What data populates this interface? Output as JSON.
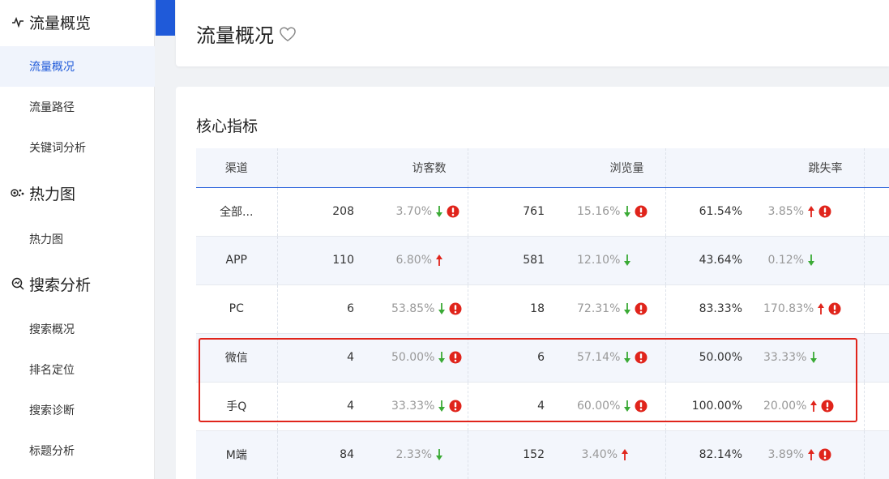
{
  "sidebar": {
    "groups": [
      {
        "label": "流量概览",
        "icon": "pulse-icon",
        "items": [
          {
            "label": "流量概况",
            "active": true
          },
          {
            "label": "流量路径",
            "active": false
          },
          {
            "label": "关键词分析",
            "active": false
          }
        ]
      },
      {
        "label": "热力图",
        "icon": "heatmap-icon",
        "items": [
          {
            "label": "热力图",
            "active": false
          }
        ]
      },
      {
        "label": "搜索分析",
        "icon": "search-analysis-icon",
        "items": [
          {
            "label": "搜索概况",
            "active": false
          },
          {
            "label": "排名定位",
            "active": false
          },
          {
            "label": "搜索诊断",
            "active": false
          },
          {
            "label": "标题分析",
            "active": false
          }
        ]
      }
    ]
  },
  "header": {
    "title": "流量概况",
    "favorite_icon": "heart-outline-icon"
  },
  "section": {
    "title": "核心指标"
  },
  "table": {
    "headers": {
      "channel": "渠道",
      "visitors": "访客数",
      "pageviews": "浏览量",
      "bounce": "跳失率"
    },
    "rows": [
      {
        "channel": "全部...",
        "visitors": "208",
        "visitors_pct": "3.70%",
        "visitors_dir": "down",
        "visitors_warn": true,
        "pageviews": "761",
        "pageviews_pct": "15.16%",
        "pageviews_dir": "down",
        "pageviews_warn": true,
        "bounce": "61.54%",
        "bounce_pct": "3.85%",
        "bounce_dir": "up",
        "bounce_warn": true
      },
      {
        "channel": "APP",
        "visitors": "110",
        "visitors_pct": "6.80%",
        "visitors_dir": "up",
        "visitors_warn": false,
        "pageviews": "581",
        "pageviews_pct": "12.10%",
        "pageviews_dir": "down",
        "pageviews_warn": false,
        "bounce": "43.64%",
        "bounce_pct": "0.12%",
        "bounce_dir": "down",
        "bounce_warn": false
      },
      {
        "channel": "PC",
        "visitors": "6",
        "visitors_pct": "53.85%",
        "visitors_dir": "down",
        "visitors_warn": true,
        "pageviews": "18",
        "pageviews_pct": "72.31%",
        "pageviews_dir": "down",
        "pageviews_warn": true,
        "bounce": "83.33%",
        "bounce_pct": "170.83%",
        "bounce_dir": "up",
        "bounce_warn": true
      },
      {
        "channel": "微信",
        "visitors": "4",
        "visitors_pct": "50.00%",
        "visitors_dir": "down",
        "visitors_warn": true,
        "pageviews": "6",
        "pageviews_pct": "57.14%",
        "pageviews_dir": "down",
        "pageviews_warn": true,
        "bounce": "50.00%",
        "bounce_pct": "33.33%",
        "bounce_dir": "down",
        "bounce_warn": false
      },
      {
        "channel": "手Q",
        "visitors": "4",
        "visitors_pct": "33.33%",
        "visitors_dir": "down",
        "visitors_warn": true,
        "pageviews": "4",
        "pageviews_pct": "60.00%",
        "pageviews_dir": "down",
        "pageviews_warn": true,
        "bounce": "100.00%",
        "bounce_pct": "20.00%",
        "bounce_dir": "up",
        "bounce_warn": true
      },
      {
        "channel": "M端",
        "visitors": "84",
        "visitors_pct": "2.33%",
        "visitors_dir": "down",
        "visitors_warn": false,
        "pageviews": "152",
        "pageviews_pct": "3.40%",
        "pageviews_dir": "up",
        "pageviews_warn": false,
        "bounce": "82.14%",
        "bounce_pct": "3.89%",
        "bounce_dir": "up",
        "bounce_warn": true
      }
    ]
  },
  "colors": {
    "accent": "#1f5ad9",
    "up": "#e0241b",
    "down": "#3aaa35",
    "warn": "#e0241b",
    "highlight": "#e0241b"
  }
}
